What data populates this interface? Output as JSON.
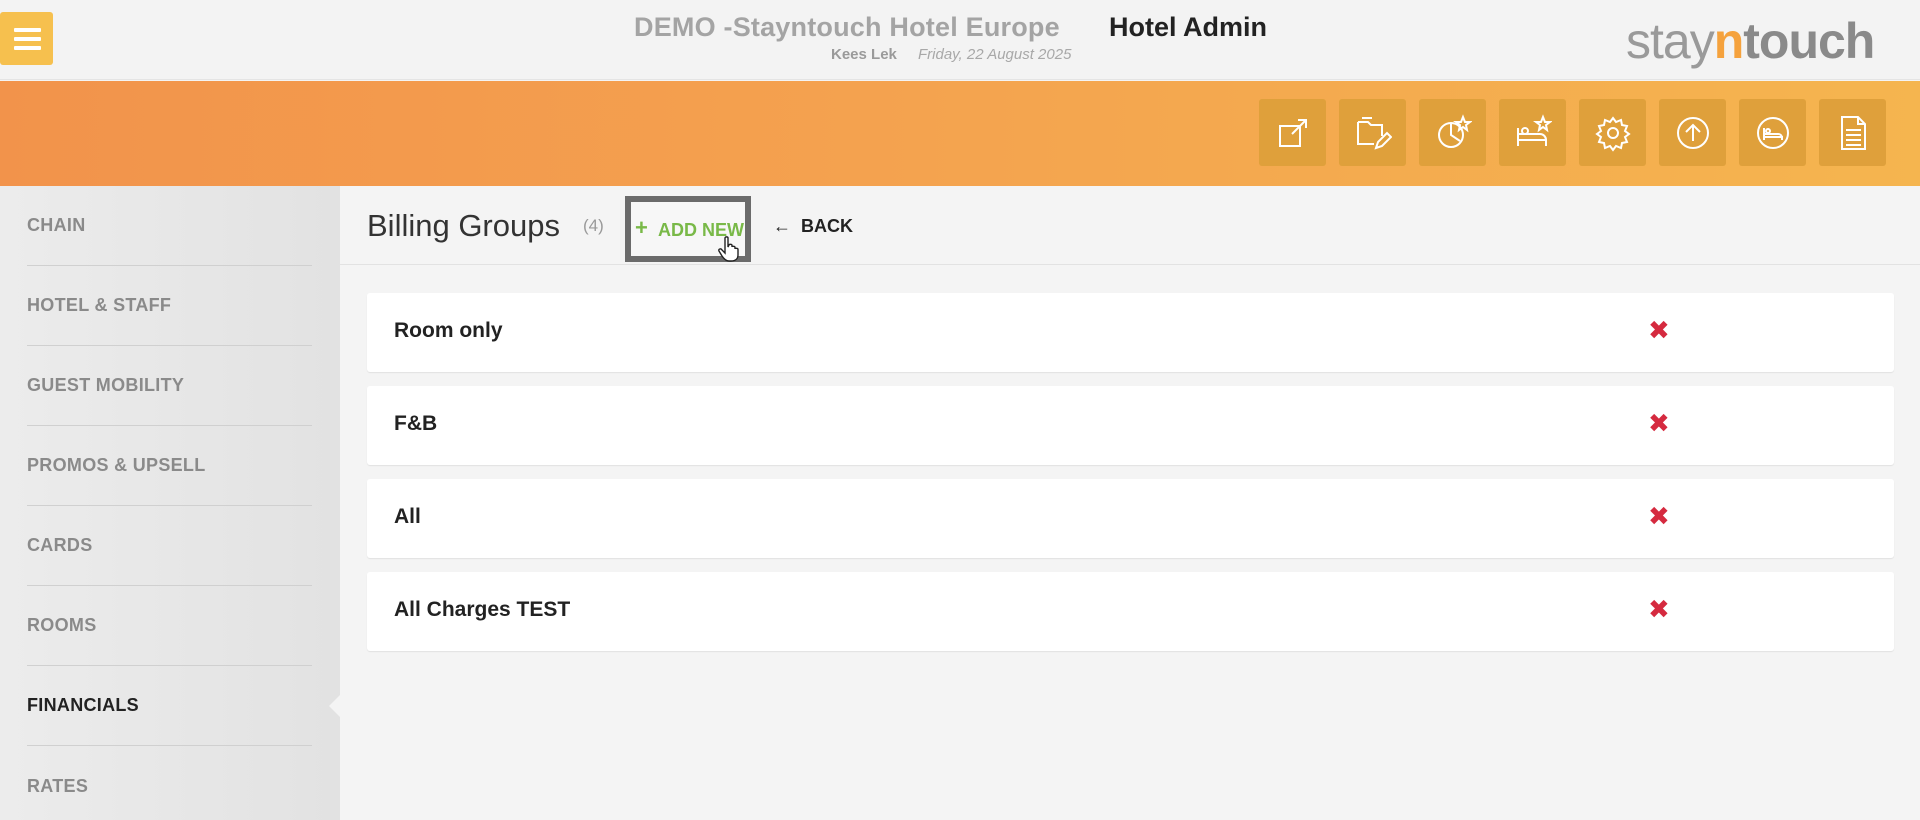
{
  "header": {
    "hotel_name": "DEMO -Stayntouch Hotel Europe",
    "app_name": "Hotel Admin",
    "user": "Kees Lek",
    "date": "Friday, 22 August 2025",
    "logo": {
      "part1": "stay",
      "part2": "n",
      "part3": "touch"
    }
  },
  "toolbar": {
    "icons": [
      "external-link-icon",
      "folder-edit-icon",
      "chart-star-icon",
      "bed-star-icon",
      "gear-icon",
      "upload-icon",
      "bed-icon",
      "document-icon"
    ]
  },
  "sidebar": {
    "items": [
      {
        "label": "CHAIN"
      },
      {
        "label": "HOTEL & STAFF"
      },
      {
        "label": "GUEST MOBILITY"
      },
      {
        "label": "PROMOS & UPSELL"
      },
      {
        "label": "CARDS"
      },
      {
        "label": "ROOMS"
      },
      {
        "label": "FINANCIALS"
      },
      {
        "label": "RATES"
      }
    ],
    "active": "FINANCIALS"
  },
  "main": {
    "title": "Billing Groups",
    "count": "(4)",
    "add_new": {
      "icon": "+",
      "label": "ADD NEW"
    },
    "back": {
      "icon": "←",
      "label": "BACK"
    },
    "rows": [
      {
        "name": "Room only",
        "delete_icon": "✖"
      },
      {
        "name": "F&B",
        "delete_icon": "✖"
      },
      {
        "name": "All",
        "delete_icon": "✖"
      },
      {
        "name": "All Charges TEST",
        "delete_icon": "✖"
      }
    ]
  },
  "colors": {
    "accent_orange": "#f4a24f",
    "menu_yellow": "#f6c04e",
    "add_green": "#79b948",
    "delete_red": "#d52a3f"
  }
}
